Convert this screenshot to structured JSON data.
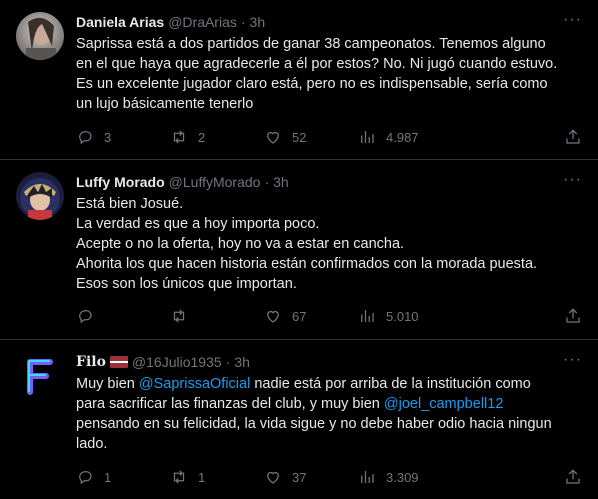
{
  "tweets": [
    {
      "name": "Daniela Arias",
      "handle": "@DraArias",
      "dot": "·",
      "time": "3h",
      "more": "···",
      "lines": [
        "Saprissa está a dos partidos de ganar 38 campeonatos. Tenemos alguno",
        "en el que haya que agradecerle a él por estos? No. Ni jugó cuando estuvo.",
        "Es un excelente jugador claro está, pero no es indispensable, sería como",
        "un lujo básicamente tenerlo"
      ],
      "replies": "3",
      "retweets": "2",
      "likes": "52",
      "views": "4.987"
    },
    {
      "name": "Luffy Morado",
      "handle": "@LuffyMorado",
      "dot": "·",
      "time": "3h",
      "more": "···",
      "lines": [
        "Está bien Josué.",
        "La verdad es que a hoy importa poco.",
        "Acepte o no la oferta, hoy no va a estar en cancha.",
        "Ahorita los que hacen historia están confirmados con la morada puesta.",
        "Esos son los únicos que importan."
      ],
      "replies": "",
      "retweets": "",
      "likes": "67",
      "views": "5.010"
    },
    {
      "name": "Filo",
      "handle": "@16Julio1935",
      "dot": "·",
      "time": "3h",
      "more": "···",
      "line1_a": "Muy bien ",
      "mention1": "@SaprissaOficial",
      "line1_b": " nadie está por arriba de la institución como",
      "line2": "para sacrificar las finanzas del club, y muy bien ",
      "mention2": "@joel_campbell12",
      "line3": "pensando en su felicidad, la vida sigue y no debe haber odio hacia ningun",
      "line4": "lado.",
      "replies": "1",
      "retweets": "1",
      "likes": "37",
      "views": "3.309"
    }
  ],
  "icons": [
    "reply-icon",
    "retweet-icon",
    "like-icon",
    "views-icon",
    "share-icon",
    "more-icon"
  ],
  "colors": {
    "background": "#000000",
    "text": "#e7e9ea",
    "muted": "#71767b",
    "link": "#1d9bf0",
    "divider": "#2f3336"
  }
}
